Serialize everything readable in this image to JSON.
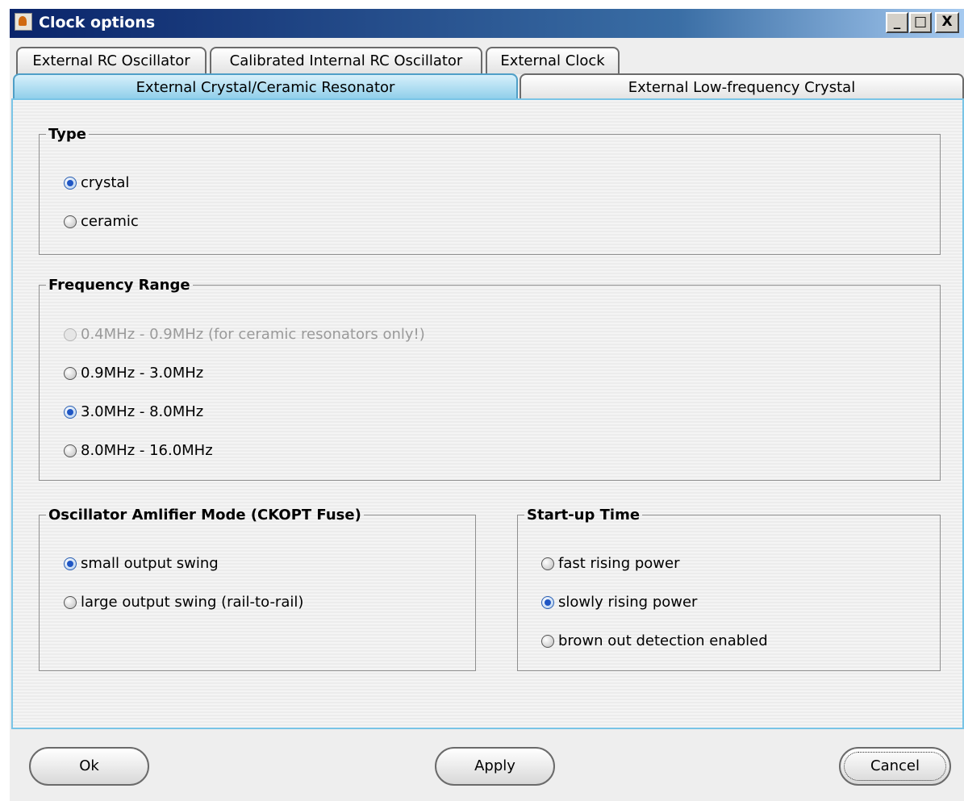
{
  "window": {
    "title": "Clock options",
    "minimize": "_",
    "maximize": "□",
    "close": "X"
  },
  "tabs": {
    "row1": [
      "External RC Oscillator",
      "Calibrated Internal RC Oscillator",
      "External Clock"
    ],
    "row2": [
      "External Crystal/Ceramic Resonator",
      "External Low-frequency Crystal"
    ],
    "selected": "External Crystal/Ceramic Resonator"
  },
  "type_group": {
    "title": "Type",
    "options": [
      {
        "label": "crystal",
        "selected": true,
        "enabled": true
      },
      {
        "label": "ceramic",
        "selected": false,
        "enabled": true
      }
    ]
  },
  "frequency_group": {
    "title": "Frequency Range",
    "options": [
      {
        "label": "0.4MHz - 0.9MHz (for ceramic resonators only!)",
        "selected": false,
        "enabled": false
      },
      {
        "label": "0.9MHz - 3.0MHz",
        "selected": false,
        "enabled": true
      },
      {
        "label": "3.0MHz - 8.0MHz",
        "selected": true,
        "enabled": true
      },
      {
        "label": "8.0MHz - 16.0MHz",
        "selected": false,
        "enabled": true
      }
    ]
  },
  "amplifier_group": {
    "title": "Oscillator Amlifier Mode (CKOPT Fuse)",
    "options": [
      {
        "label": "small output swing",
        "selected": true,
        "enabled": true
      },
      {
        "label": "large output swing (rail-to-rail)",
        "selected": false,
        "enabled": true
      }
    ]
  },
  "startup_group": {
    "title": "Start-up Time",
    "options": [
      {
        "label": "fast rising power",
        "selected": false,
        "enabled": true
      },
      {
        "label": "slowly rising power",
        "selected": true,
        "enabled": true
      },
      {
        "label": "brown out detection enabled",
        "selected": false,
        "enabled": true
      }
    ]
  },
  "buttons": {
    "ok": "Ok",
    "apply": "Apply",
    "cancel": "Cancel"
  },
  "colors": {
    "title_bar": "#0a246a",
    "selected_tab": "#8ccde9",
    "panel_border": "#79c4e6",
    "radio_dot": "#1f56c4"
  }
}
